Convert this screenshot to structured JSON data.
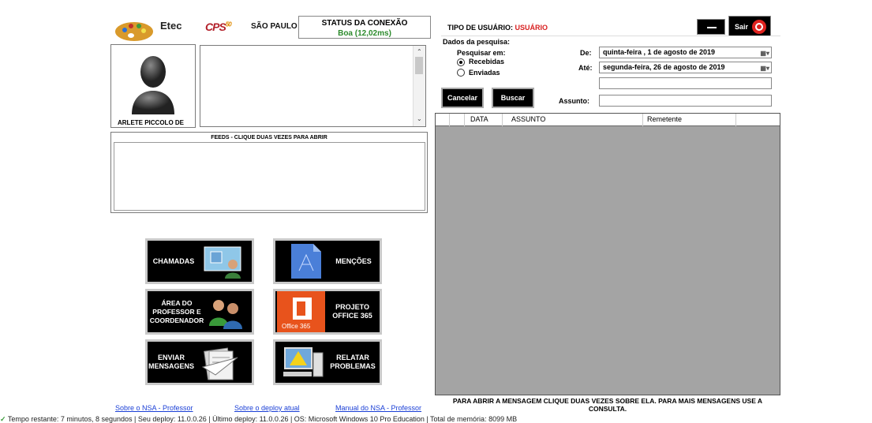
{
  "header": {
    "logos": {
      "etec": "Etec",
      "cps": "CPS",
      "sp": "SÃO PAULO"
    },
    "status": {
      "title": "STATUS DA CONEXÃO",
      "value": "Boa (12,02ms)"
    },
    "user_type_label": "TIPO DE USUÁRIO:",
    "user_type_value": "USUÁRIO",
    "exit_label": "Sair"
  },
  "profile": {
    "name": "ARLETE PICCOLO DE"
  },
  "feeds": {
    "label": "FEEDS - CLIQUE DUAS VEZES PARA ABRIR"
  },
  "tiles": [
    {
      "label": "CHAMADAS",
      "icon": "calls-icon"
    },
    {
      "label": "MENÇÕES",
      "icon": "mentions-icon"
    },
    {
      "label": "ÁREA DO PROFESSOR E COORDENADOR",
      "icon": "teachers-icon"
    },
    {
      "label": "PROJETO OFFICE 365",
      "icon": "office365-icon"
    },
    {
      "label": "ENVIAR MENSAGENS",
      "icon": "send-messages-icon"
    },
    {
      "label": "RELATAR PROBLEMAS",
      "icon": "report-problem-icon"
    }
  ],
  "office_badge": "Office 365",
  "footer_links": [
    "Sobre o NSA - Professor",
    "Sobre o deploy atual",
    "Manual do NSA - Professor"
  ],
  "statusbar": "Tempo restante: 7 minutos, 8 segundos | Seu deploy: 11.0.0.26 | Último deploy: 11.0.0.26 | OS: Microsoft Windows 10 Pro Education | Total de memória: 8099 MB",
  "search": {
    "title": "Dados da pesquisa:",
    "search_in_label": "Pesquisar em:",
    "options": [
      "Recebidas",
      "Enviadas"
    ],
    "selected": "Recebidas",
    "from_label": "De:",
    "from_value": "quinta-feira ,  1 de   agosto   de 2019",
    "to_label": "Até:",
    "to_value": "segunda-feira, 26 de   agosto   de 2019",
    "subject_label": "Assunto:",
    "cancel_label": "Cancelar",
    "search_label": "Buscar"
  },
  "grid": {
    "columns": [
      "DATA",
      "ASSUNTO",
      "Remetente"
    ],
    "footer": "PARA ABRIR A MENSAGEM CLIQUE DUAS VEZES SOBRE ELA. PARA MAIS MENSAGENS USE A CONSULTA."
  }
}
